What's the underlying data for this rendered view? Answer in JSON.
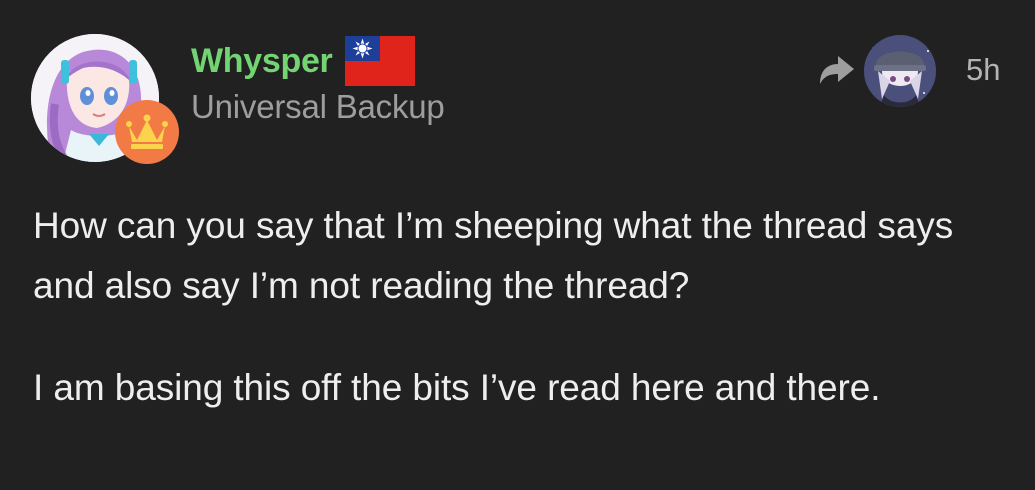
{
  "post": {
    "author": {
      "username": "Whysper",
      "title": "Universal Backup",
      "flag_icon": "taiwan-flag-icon",
      "badge_icon": "crown-icon"
    },
    "timestamp": "5h",
    "reply_icon": "share-arrow-icon",
    "paragraphs": [
      "How can you say that I’m sheeping what the thread says and also say I’m not reading the thread?",
      "I am basing this off the bits I’ve read here and there."
    ]
  },
  "colors": {
    "background": "#212121",
    "username": "#72d572",
    "title": "#9e9e9e",
    "body_text": "#eeeeee",
    "badge": "#f27a45"
  }
}
